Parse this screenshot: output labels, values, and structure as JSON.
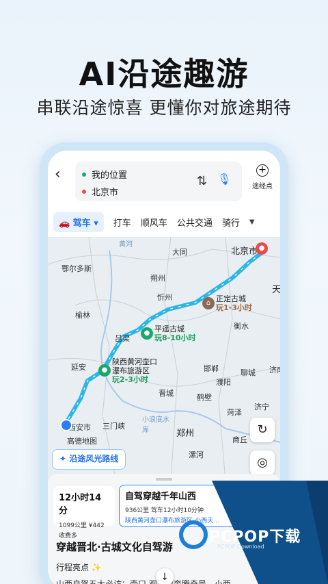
{
  "promo": {
    "headline": "AI沿途趣游",
    "subhead": "串联沿途惊喜 更懂你对旅途期待"
  },
  "route": {
    "origin": "我的位置",
    "destination": "北京市",
    "via_label": "途经点"
  },
  "modes": {
    "active": "驾车",
    "items": [
      "打车",
      "顺风车",
      "公共交通",
      "骑行"
    ]
  },
  "map": {
    "cities": [
      "大同",
      "朔州",
      "忻州",
      "鄂尔多斯",
      "榆林",
      "吕梁",
      "延安",
      "晋城",
      "鹤壁",
      "濮阳",
      "邯郸",
      "衡水",
      "聊城",
      "济南",
      "菏泽",
      "济宁",
      "商丘",
      "漯河",
      "郑州",
      "三门峡",
      "西安市",
      "天"
    ],
    "rivers": [
      "黄河",
      "小浪底水库"
    ],
    "destination_label": "北京市",
    "pois": [
      {
        "name": "正定古城",
        "detail": "玩1-3小时"
      },
      {
        "name": "平遥古城",
        "detail": "玩8-10小时"
      },
      {
        "name": "陕西黄河壶口",
        "name2": "瀑布旅游区",
        "detail": "玩2-3小时"
      }
    ],
    "brand": "高德地图",
    "scenic_button": "沿途风光路线",
    "accent_color": "#2bb6e6"
  },
  "plans": [
    {
      "title": "12小时14分",
      "line1": "1099公里 ¥442",
      "line2": "收费多"
    },
    {
      "title": "自驾穿越千年山西",
      "line1": "936公里 驾车12小时10分钟",
      "line2": "陕西黄河壶口瀑布旅游区-小西天..."
    }
  ],
  "detail": {
    "title": "穿越晋北·古城文化自驾游",
    "highlights_title": "行程亮点 ✨",
    "highlights_text": "山西自驾五大必访：壶口 观黄河奔腾奇景，小西"
  },
  "watermark": {
    "brand": "PCPOP下载",
    "sub": "PCPOP Download"
  }
}
